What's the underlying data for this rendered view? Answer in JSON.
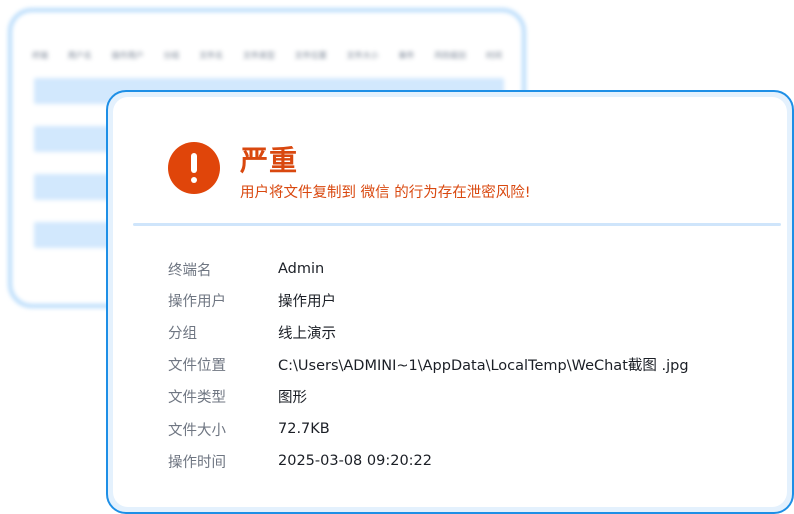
{
  "background_table": {
    "headers": [
      "终端",
      "用户名",
      "操作用户",
      "分组",
      "文件名",
      "文件类型",
      "文件位置",
      "文件大小",
      "事件",
      "风险级别",
      "时间"
    ],
    "row_count": 4
  },
  "alert": {
    "icon": "exclamation-icon",
    "level": "严重",
    "message": "用户将文件复制到 微信 的行为存在泄密风险!",
    "fields": [
      {
        "label": "终端名",
        "value": "Admin"
      },
      {
        "label": "操作用户",
        "value": "操作用户"
      },
      {
        "label": "分组",
        "value": "线上演示"
      },
      {
        "label": "文件位置",
        "value": "C:\\Users\\ADMINI~1\\AppData\\LocalTemp\\WeChat截图 .jpg"
      },
      {
        "label": "文件类型",
        "value": "图形"
      },
      {
        "label": "文件大小",
        "value": "72.7KB"
      },
      {
        "label": "操作时间",
        "value": "2025-03-08 09:20:22"
      }
    ]
  },
  "colors": {
    "danger": "#d9480f",
    "icon_bg": "#e0450a",
    "border_blue": "#1e8fe6",
    "row_blue": "#d2e8fd"
  }
}
